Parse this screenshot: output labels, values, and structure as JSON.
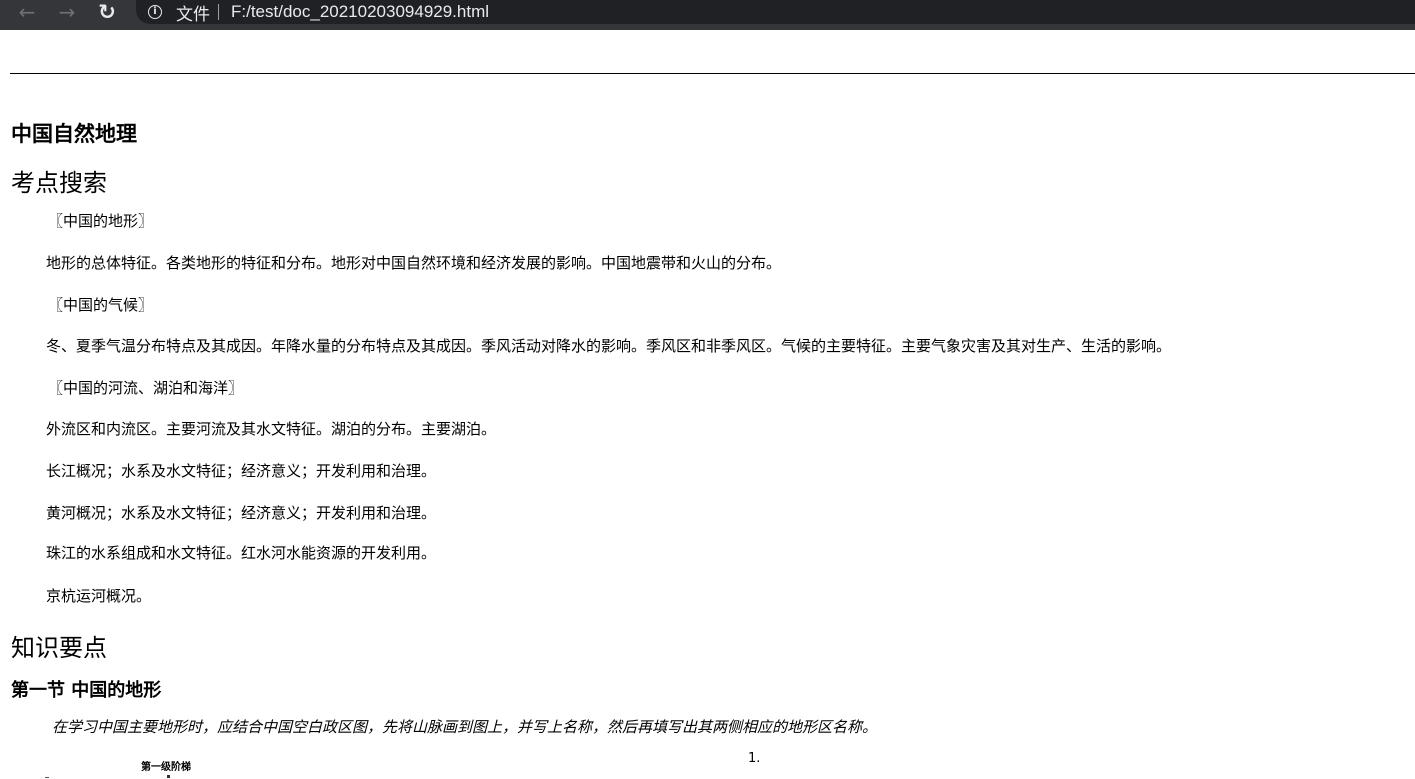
{
  "browser": {
    "scheme_label": "文件",
    "url": "F:/test/doc_20210203094929.html",
    "icons": [
      "back-arrow-icon",
      "forward-arrow-icon",
      "reload-icon",
      "info-icon"
    ]
  },
  "document": {
    "title": "中国自然地理",
    "section1": {
      "heading": "考点搜索",
      "paragraphs": [
        "〖中国的地形〗",
        "地形的总体特征。各类地形的特征和分布。地形对中国自然环境和经济发展的影响。中国地震带和火山的分布。",
        "〖中国的气候〗",
        "冬、夏季气温分布特点及其成因。年降水量的分布特点及其成因。季风活动对降水的影响。季风区和非季风区。气候的主要特征。主要气象灾害及其对生产、生活的影响。",
        "〖中国的河流、湖泊和海洋〗",
        "外流区和内流区。主要河流及其水文特征。湖泊的分布。主要湖泊。",
        "长江概况；水系及水文特征；经济意义；开发利用和治理。",
        "黄河概况；水系及水文特征；经济意义；开发利用和治理。",
        "珠江的水系组成和水文特征。红水河水能资源的开发利用。",
        "京杭运河概况。"
      ]
    },
    "section2": {
      "heading": "知识要点",
      "subheading": "第一节  中国的地形",
      "note": "在学习中国主要地形时，应结合中国空白政区图，先将山脉画到图上，并写上名称，然后再填写出其两侧相应的地形区名称。",
      "page_number": "1.",
      "image_caption": "第一级阶梯"
    }
  }
}
